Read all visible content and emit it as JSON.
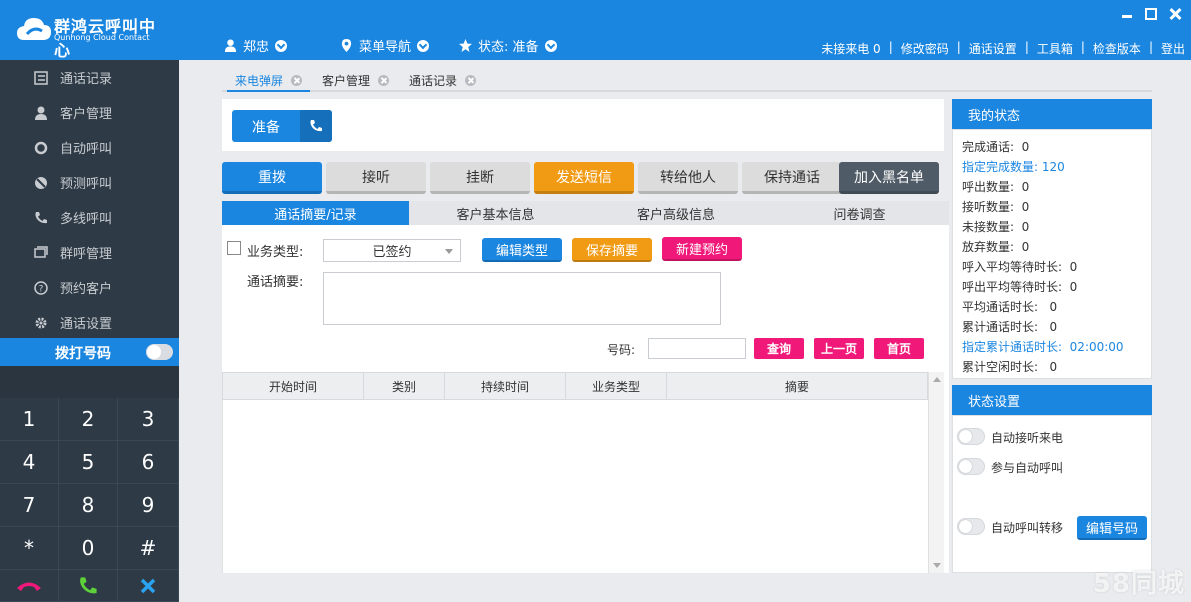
{
  "app": {
    "logo_cn": "群鸿云呼叫中心",
    "logo_en": "Qunhong Cloud Contact"
  },
  "topmenu": {
    "user": "郑忠",
    "menu_nav": "菜单导航",
    "status": "状态: 准备"
  },
  "toplinks": {
    "missed_calls": "未接来电 0",
    "change_password": "修改密码",
    "call_settings": "通话设置",
    "toolbox": "工具箱",
    "check_version": "检查版本",
    "logout": "登出"
  },
  "sidebar": {
    "items": [
      {
        "label": "通话记录",
        "icon": "list-icon"
      },
      {
        "label": "客户管理",
        "icon": "user-icon"
      },
      {
        "label": "自动呼叫",
        "icon": "ring-icon"
      },
      {
        "label": "预测呼叫",
        "icon": "forecast-icon"
      },
      {
        "label": "多线呼叫",
        "icon": "phone-icon"
      },
      {
        "label": "群呼管理",
        "icon": "chat-icon"
      },
      {
        "label": "预约客户",
        "icon": "question-icon"
      },
      {
        "label": "通话设置",
        "icon": "gear-icon"
      }
    ],
    "dial_label": "拨打号码",
    "keys": [
      "1",
      "2",
      "3",
      "4",
      "5",
      "6",
      "7",
      "8",
      "9",
      "*",
      "0",
      "#"
    ]
  },
  "page_tabs": [
    "来电弹屏",
    "客户管理",
    "通话记录"
  ],
  "ready_label": "准备",
  "actions": {
    "redial": "重拨",
    "answer": "接听",
    "hangup": "挂断",
    "send_sms": "发送短信",
    "transfer": "转给他人",
    "hold": "保持通话",
    "blacklist": "加入黑名单"
  },
  "sub_tabs": [
    "通话摘要/记录",
    "客户基本信息",
    "客户高级信息",
    "问卷调查"
  ],
  "form": {
    "business_type_label": "业务类型:",
    "business_type_value": "已签约",
    "edit_type": "编辑类型",
    "save_summary": "保存摘要",
    "new_appointment": "新建预约",
    "summary_label": "通话摘要:",
    "number_label": "号码:",
    "query": "查询",
    "prev_page": "上一页",
    "first_page": "首页"
  },
  "table": {
    "columns": [
      "开始时间",
      "类别",
      "持续时间",
      "业务类型",
      "摘要"
    ]
  },
  "my_status": {
    "title": "我的状态",
    "lines": [
      {
        "text": "完成通话:  0",
        "highlight": false
      },
      {
        "text": "指定完成数量: 120",
        "highlight": true
      },
      {
        "text": "呼出数量:  0",
        "highlight": false
      },
      {
        "text": "接听数量:  0",
        "highlight": false
      },
      {
        "text": "未接数量:  0",
        "highlight": false
      },
      {
        "text": "放弃数量:  0",
        "highlight": false
      },
      {
        "text": "呼入平均等待时长:  0",
        "highlight": false
      },
      {
        "text": "呼出平均等待时长:  0",
        "highlight": false
      },
      {
        "text": "平均通话时长:   0",
        "highlight": false
      },
      {
        "text": "累计通话时长:   0",
        "highlight": false
      },
      {
        "text": "指定累计通话时长:  02:00:00",
        "highlight": true
      },
      {
        "text": "累计空闲时长:   0",
        "highlight": false
      }
    ]
  },
  "status_settings": {
    "title": "状态设置",
    "auto_answer": "自动接听来电",
    "join_auto_call": "参与自动呼叫",
    "auto_transfer": "自动呼叫转移",
    "edit_number": "编辑号码"
  },
  "watermark": "58同城",
  "colors": {
    "primary": "#1b86e0",
    "orange": "#f19a14",
    "pink": "#f0197a",
    "dark": "#4f5b66",
    "sidebar": "#2e3a46"
  }
}
